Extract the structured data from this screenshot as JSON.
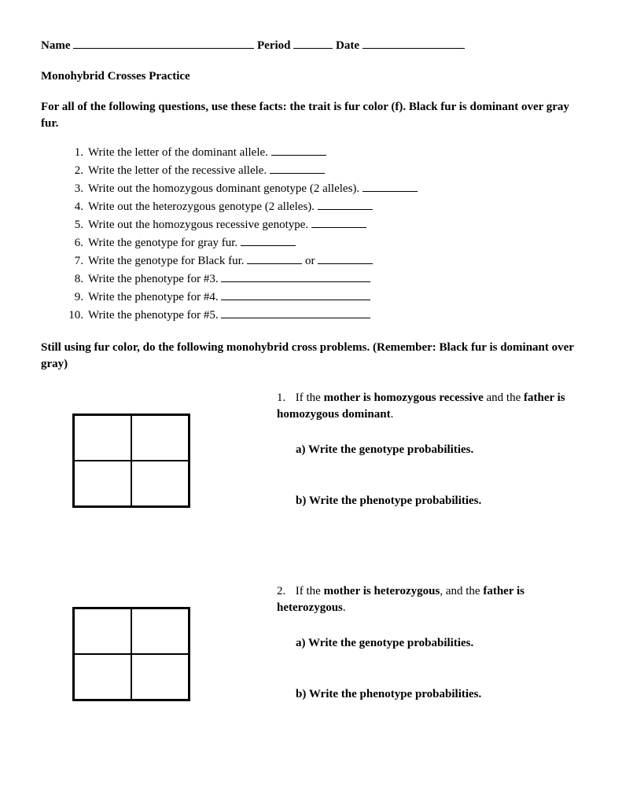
{
  "header": {
    "name_label": "Name",
    "period_label": "Period",
    "date_label": "Date"
  },
  "title": "Monohybrid Crosses Practice",
  "instructions": "For all of the following questions, use these facts: the trait is fur color (f). Black fur is dominant over gray fur.",
  "questions": [
    {
      "num": "1.",
      "text": "Write the letter of the dominant allele.",
      "blank": "short"
    },
    {
      "num": "2.",
      "text": "Write the letter of the recessive allele.",
      "blank": "short"
    },
    {
      "num": "3.",
      "text": "Write out the homozygous dominant genotype (2 alleles).",
      "blank": "short"
    },
    {
      "num": "4.",
      "text": "Write out the heterozygous genotype (2 alleles).",
      "blank": "short"
    },
    {
      "num": "5.",
      "text": "Write out the homozygous recessive genotype.",
      "blank": "short"
    },
    {
      "num": "6.",
      "text": "Write the genotype for gray fur.",
      "blank": "short"
    },
    {
      "num": "7.",
      "text": "Write the genotype for Black fur.",
      "blank": "or"
    },
    {
      "num": "8.",
      "text": "Write the phenotype for #3.",
      "blank": "wide"
    },
    {
      "num": "9.",
      "text": "Write the phenotype for #4.",
      "blank": "wide"
    },
    {
      "num": "10.",
      "text": "Write the phenotype for #5.",
      "blank": "wide"
    }
  ],
  "or_text": "or",
  "section2_header": "Still using fur color, do the following monohybrid cross problems. (Remember: Black fur is dominant over gray)",
  "problems": [
    {
      "num": "1.",
      "prefix": "If the ",
      "bold1": "mother is homozygous recessive",
      "mid": " and the ",
      "bold2": "father is homozygous dominant",
      "suffix": ".",
      "a": "a) Write the genotype probabilities.",
      "b": "b) Write the phenotype probabilities."
    },
    {
      "num": "2.",
      "prefix": "If the ",
      "bold1": "mother is heterozygous",
      "mid": ", and the ",
      "bold2": "father is heterozygous",
      "suffix": ".",
      "a": "a) Write the genotype probabilities.",
      "b": "b) Write the phenotype probabilities."
    }
  ]
}
